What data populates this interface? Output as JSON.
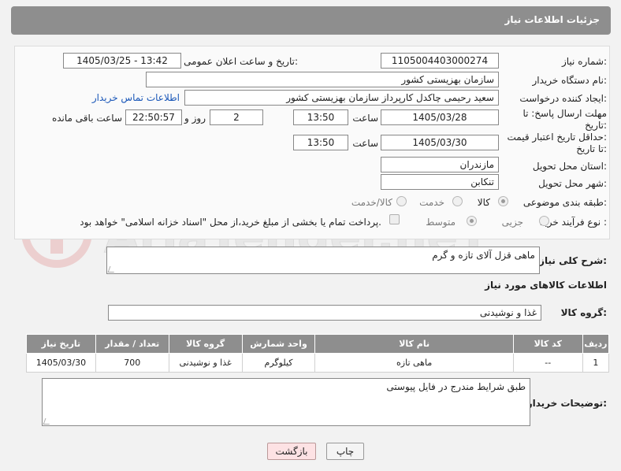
{
  "header": {
    "title": "جزئیات اطلاعات نیاز"
  },
  "form": {
    "need_number": {
      "label": "شماره نیاز:",
      "value": "1105004403000274"
    },
    "announce": {
      "label": "تاریخ و ساعت اعلان عمومی:",
      "value": "1405/03/25 - 13:42"
    },
    "buyer_org": {
      "label": "نام دستگاه خریدار:",
      "value": "سازمان بهزیستی کشور"
    },
    "creator": {
      "label": "ایجاد کننده درخواست:",
      "value": "سعید رحیمی چاکدل کارپرداز سازمان بهزیستی کشور",
      "contact_link": "اطلاعات تماس خریدار"
    },
    "deadline": {
      "label1": "مهلت ارسال پاسخ: تا",
      "label2": "تاریخ:",
      "date": "1405/03/28",
      "time_label": "ساعت",
      "time": "13:50",
      "days": "2",
      "days_label": "روز و",
      "remaining": "22:50:57",
      "remaining_label": "ساعت باقی مانده"
    },
    "price_validity": {
      "label1": "حداقل تاریخ اعتبار قیمت:",
      "label2": "تا تاریخ:",
      "date": "1405/03/30",
      "time_label": "ساعت",
      "time": "13:50"
    },
    "province": {
      "label": "استان محل تحویل:",
      "value": "مازندران"
    },
    "city": {
      "label": "شهر محل تحویل:",
      "value": "تنکابن"
    },
    "category": {
      "label": "طبقه بندی موضوعی:",
      "options": [
        "کالا",
        "خدمت",
        "کالا/خدمت"
      ],
      "selected": "کالا"
    },
    "process": {
      "label": "نوع فرآیند خرید :",
      "options": [
        "جزیی",
        "متوسط"
      ],
      "selected": "متوسط",
      "payment_note": "پرداخت تمام یا بخشی از مبلغ خرید،از محل \"اسناد خزانه اسلامی\" خواهد بود."
    }
  },
  "description": {
    "label": "شرح کلی نیاز:",
    "value": "ماهی قزل آلای تازه و گرم"
  },
  "goods_section": {
    "title": "اطلاعات کالاهای مورد نیاز"
  },
  "goods_group": {
    "label": "گروه کالا:",
    "value": "غذا و نوشیدنی"
  },
  "table": {
    "headers": [
      "ردیف",
      "کد کالا",
      "نام کالا",
      "واحد شمارش",
      "گروه کالا",
      "تعداد / مقدار",
      "تاریخ نیاز"
    ],
    "rows": [
      [
        "1",
        "--",
        "ماهی تازه",
        "کیلوگرم",
        "غذا و نوشیدنی",
        "700",
        "1405/03/30"
      ]
    ]
  },
  "buyer_notes": {
    "label": "توضیحات خریدار:",
    "value": "طبق شرایط مندرج در فایل پیوستی"
  },
  "buttons": {
    "print": "چاپ",
    "back": "بازگشت"
  },
  "colors": {
    "header_bg": "#8e8e8e",
    "link": "#1a57b8",
    "back_button": "#fde2e4",
    "watermark": "#e8b4b4"
  }
}
